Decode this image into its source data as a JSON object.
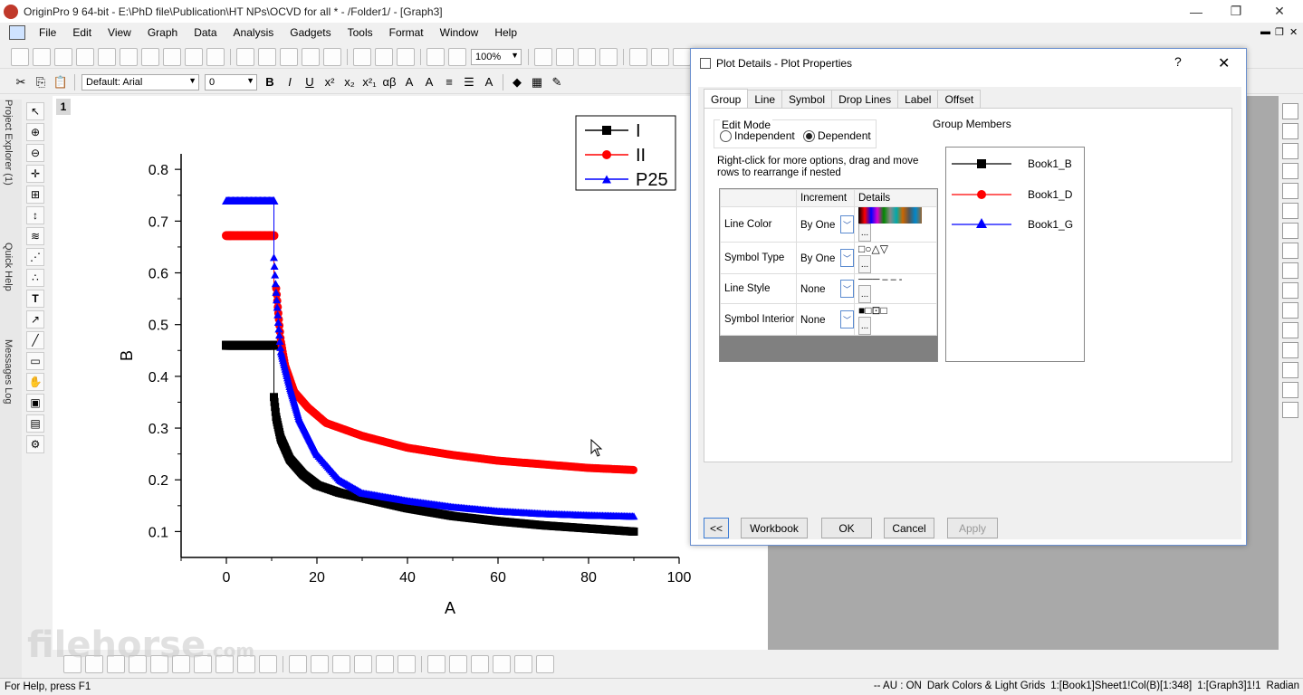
{
  "window": {
    "title": "OriginPro 9 64-bit - E:\\PhD file\\Publication\\HT NPs\\OCVD for all * - /Folder1/ - [Graph3]",
    "min": "—",
    "max": "❐",
    "close": "✕"
  },
  "menu": [
    "File",
    "Edit",
    "View",
    "Graph",
    "Data",
    "Analysis",
    "Gadgets",
    "Tools",
    "Format",
    "Window",
    "Help"
  ],
  "toolbar": {
    "zoom": "100%",
    "font": "Default: Arial",
    "font_size": "0"
  },
  "format_buttons": [
    "B",
    "I",
    "U",
    "x²",
    "x₂",
    "x²₁",
    "αβ",
    "A",
    "A"
  ],
  "side_tabs": [
    "Project Explorer (1)",
    "Quick Help",
    "Messages Log"
  ],
  "layer_label": "1",
  "chart_data": {
    "type": "scatter",
    "xlabel": "A",
    "ylabel": "B",
    "xlim": [
      -10,
      100
    ],
    "ylim": [
      0.05,
      0.83
    ],
    "xticks": [
      "0",
      "20",
      "40",
      "60",
      "80",
      "100"
    ],
    "yticks": [
      "0.1",
      "0.2",
      "0.3",
      "0.4",
      "0.5",
      "0.6",
      "0.7",
      "0.8"
    ],
    "legend_position": "top-right",
    "series": [
      {
        "name": "I",
        "color": "#000000",
        "marker": "square",
        "flat_y": 0.46,
        "x_drop": 10.5,
        "points": [
          [
            10.5,
            0.36
          ],
          [
            11,
            0.32
          ],
          [
            12,
            0.28
          ],
          [
            14,
            0.24
          ],
          [
            17,
            0.21
          ],
          [
            20,
            0.19
          ],
          [
            25,
            0.175
          ],
          [
            30,
            0.165
          ],
          [
            40,
            0.145
          ],
          [
            50,
            0.13
          ],
          [
            60,
            0.12
          ],
          [
            70,
            0.112
          ],
          [
            80,
            0.106
          ],
          [
            90,
            0.1
          ]
        ]
      },
      {
        "name": "II",
        "color": "#ff0000",
        "marker": "circle",
        "flat_y": 0.672,
        "x_drop": 10.5,
        "points": [
          [
            11,
            0.57
          ],
          [
            11.5,
            0.52
          ],
          [
            12,
            0.47
          ],
          [
            13,
            0.42
          ],
          [
            15,
            0.37
          ],
          [
            18,
            0.34
          ],
          [
            22,
            0.31
          ],
          [
            30,
            0.285
          ],
          [
            40,
            0.262
          ],
          [
            50,
            0.248
          ],
          [
            60,
            0.237
          ],
          [
            70,
            0.23
          ],
          [
            80,
            0.223
          ],
          [
            90,
            0.219
          ]
        ]
      },
      {
        "name": "P25",
        "color": "#0000ff",
        "marker": "triangle",
        "flat_y": 0.74,
        "x_drop": 10.5,
        "points": [
          [
            10.5,
            0.63
          ],
          [
            11,
            0.56
          ],
          [
            11.5,
            0.5
          ],
          [
            12,
            0.45
          ],
          [
            14,
            0.38
          ],
          [
            16,
            0.32
          ],
          [
            20,
            0.25
          ],
          [
            25,
            0.2
          ],
          [
            30,
            0.175
          ],
          [
            40,
            0.16
          ],
          [
            50,
            0.148
          ],
          [
            60,
            0.14
          ],
          [
            70,
            0.135
          ],
          [
            80,
            0.132
          ],
          [
            90,
            0.13
          ]
        ]
      }
    ]
  },
  "dialog": {
    "title": "Plot Details - Plot Properties",
    "help": "?",
    "close": "✕",
    "tabs": [
      "Group",
      "Line",
      "Symbol",
      "Drop Lines",
      "Label",
      "Offset"
    ],
    "edit_mode": {
      "legend": "Edit Mode",
      "independent": "Independent",
      "dependent": "Dependent",
      "selected": "dependent"
    },
    "hint": "Right-click for more options, drag and move rows to  rearrange if nested",
    "group_members_label": "Group Members",
    "grid_headers": [
      "",
      "Increment",
      "Details"
    ],
    "grid_rows": [
      {
        "label": "Line Color",
        "increment": "By One"
      },
      {
        "label": "Symbol Type",
        "increment": "By One"
      },
      {
        "label": "Line Style",
        "increment": "None"
      },
      {
        "label": "Symbol Interior",
        "increment": "None"
      }
    ],
    "members": [
      {
        "name": "Book1_B",
        "color": "#000000"
      },
      {
        "name": "Book1_D",
        "color": "#ff0000"
      },
      {
        "name": "Book1_G",
        "color": "#0000ff"
      }
    ],
    "buttons": {
      "collapse": "<<",
      "workbook": "Workbook",
      "ok": "OK",
      "cancel": "Cancel",
      "apply": "Apply"
    }
  },
  "status": {
    "help": "For Help, press F1",
    "au": "-- AU : ON",
    "theme": "Dark Colors & Light Grids",
    "cell": "1:[Book1]Sheet1!Col(B)[1:348]",
    "graph": "1:[Graph3]1!1",
    "angle": "Radian"
  },
  "watermark": {
    "text": "filehorse",
    "suffix": ".com"
  }
}
